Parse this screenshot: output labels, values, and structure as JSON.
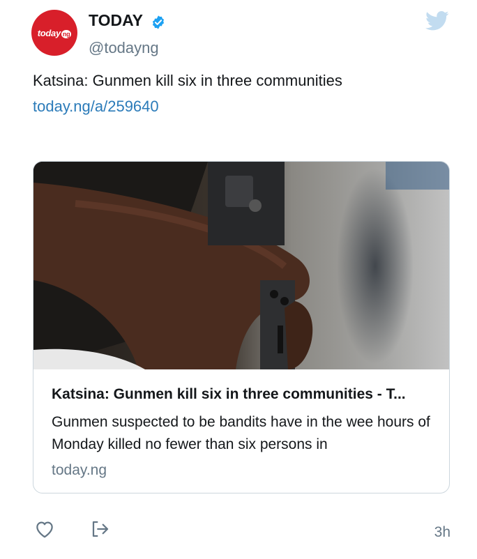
{
  "author": {
    "display_name": "TODAY",
    "handle": "@todayng",
    "avatar_text": "today",
    "avatar_badge": "ng",
    "verified": true,
    "brand_color": "#d81f2a"
  },
  "tweet": {
    "text": "Katsina: Gunmen kill six in three communities",
    "link": "today.ng/a/259640",
    "time": "3h"
  },
  "card": {
    "title": "Katsina: Gunmen kill six in three communities - T...",
    "description": "Gunmen suspected to be bandits have in the wee hours of Monday killed no fewer than six persons in",
    "domain": "today.ng",
    "image_icon": "rifle-in-hand-photo"
  },
  "colors": {
    "link": "#2b7bb9",
    "muted": "#657786",
    "verified": "#1da1f2",
    "bird": "#c2dcf0"
  }
}
